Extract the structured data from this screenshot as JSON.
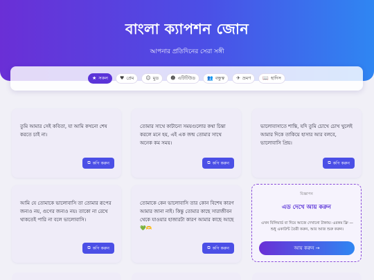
{
  "header": {
    "title": "বাংলা ক্যাপশন জোন",
    "subtitle": "আপনার প্রতিদিনের সেরা সঙ্গী"
  },
  "filters": [
    {
      "label": "সকল",
      "icon": "★",
      "icon_name": "star-icon",
      "active": true
    },
    {
      "label": "প্রেম",
      "icon": "♥",
      "icon_name": "heart-icon",
      "active": false
    },
    {
      "label": "মুড",
      "icon": "☺",
      "icon_name": "smile-icon",
      "active": false
    },
    {
      "label": "এটিটিউড",
      "icon": "☻",
      "icon_name": "attitude-face-icon",
      "active": false
    },
    {
      "label": "বন্ধুত্ব",
      "icon": "👥",
      "icon_name": "friends-icon",
      "active": false
    },
    {
      "label": "ভ্রমণ",
      "icon": "✈",
      "icon_name": "plane-icon",
      "active": false
    },
    {
      "label": "হাদিস",
      "icon": "📖",
      "icon_name": "book-icon",
      "active": false
    }
  ],
  "copy_label": "কপি করুন",
  "copy_icon": "⧉",
  "captions": [
    {
      "text": "তুমি আমার সেই কবিতা, যা আমি কখনো শেষ করতে চাই না।"
    },
    {
      "text": "তোমার সাথে কাটানো সময়গুলোর কথা চিন্তা করলে মনে হয়, এই এক জন্ম তোমার সাথে অনেক কম সময়।"
    },
    {
      "text": "ভালোবাসাতে শান্তি, যদি তুমি চোখে চোখ খুলেই আমার দিকে তাকিয়ে হাসার আর বলবে, ভালোবাসি প্রিয়।"
    },
    {
      "text": "আমি যে তোমাকে ভালোবাসি তা তোমার রূপের জন্যও নয়, গুণের জন্যও নয়। তাকো না রেখে থাকতেই পারি না বলে ভালোবাসি।"
    },
    {
      "text": "তোমাকে কেন ভালোবাসি তার কোন বিশেষ কারণ আমার জানা নাই। কিন্তু তোমার কাছে সারাজীবন থেকে যাওয়ার হাজারটা কারণ আমার কাছে আছে 💚🫶"
    }
  ],
  "ad": {
    "tag": "বিজ্ঞাপন",
    "title": "এড দেখে আয় করুন",
    "description": "এখন বিলিয়ার্ড বা দিয়ে আজে দেখানো টাকায়। এরকম ফ্রি — শুধু একাউন্ট তৈরী করুন, আর আজ শুরু করুন।",
    "button": "আয় করুন →"
  },
  "colors": {
    "accent": "#5b34d8",
    "copy_button": "#4b4fe6",
    "gradient_start": "#6a2fd6",
    "gradient_end": "#2f86f2"
  }
}
